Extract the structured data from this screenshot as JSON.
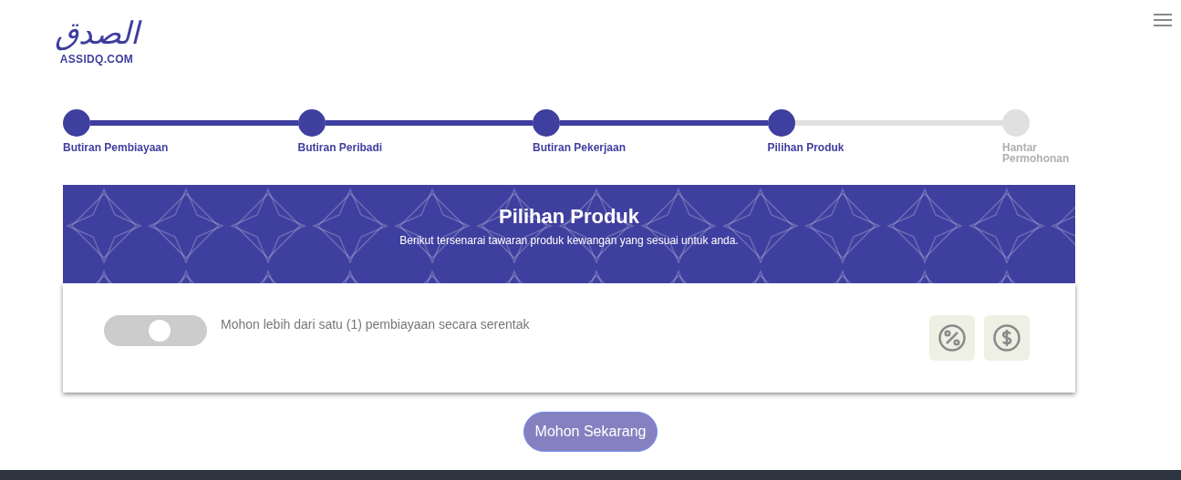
{
  "logo": {
    "script": "الصدق",
    "domain": "ASSIDQ.COM"
  },
  "steps": [
    {
      "label": "Butiran Pembiayaan",
      "done": true
    },
    {
      "label": "Butiran Peribadi",
      "done": true
    },
    {
      "label": "Butiran Pekerjaan",
      "done": true
    },
    {
      "label": "Pilihan Produk",
      "done": true
    },
    {
      "label": "Hantar Permohonan",
      "done": false
    }
  ],
  "banner": {
    "title": "Pilihan Produk",
    "subtitle": "Berikut tersenarai tawaran produk kewangan yang sesuai untuk anda."
  },
  "option": {
    "label": "Mohon lebih dari satu (1) pembiayaan secara serentak",
    "on": false
  },
  "apply_button": "Mohon Sekarang"
}
